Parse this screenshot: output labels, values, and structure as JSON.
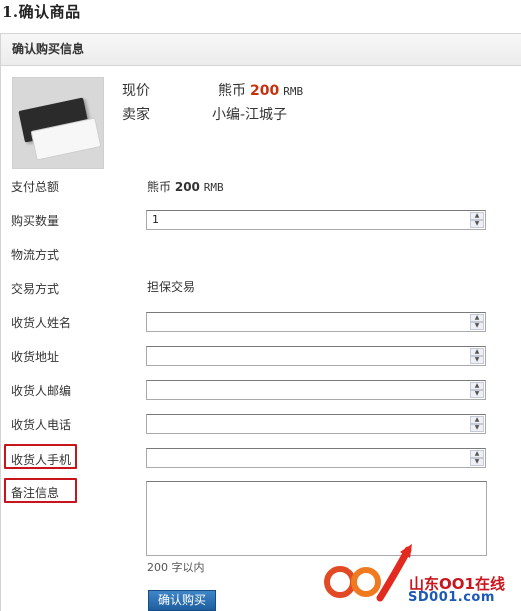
{
  "section_title": "1.确认商品",
  "panel": {
    "header": "确认购买信息"
  },
  "product": {
    "price_label": "现价",
    "currency": "熊币",
    "price": "200",
    "unit": "RMB",
    "seller_label": "卖家",
    "seller": "小编-江城子"
  },
  "form": {
    "total_label": "支付总额",
    "total_currency": "熊币",
    "total_value": "200",
    "total_unit": "RMB",
    "quantity_label": "购买数量",
    "quantity_value": "1",
    "logistics_label": "物流方式",
    "trade_label": "交易方式",
    "trade_value": "担保交易",
    "name_label": "收货人姓名",
    "address_label": "收货地址",
    "zip_label": "收货人邮编",
    "phone_label": "收货人电话",
    "mobile_label": "收货人手机",
    "remark_label": "备注信息",
    "remark_hint": "200 字以内"
  },
  "buy_button": "确认购买",
  "watermark": {
    "line1": "山东OO1在线",
    "line2": "SD001.com"
  },
  "colors": {
    "price": "#c5320e",
    "highlight": "#c8151b",
    "button": "#2a6db2"
  }
}
